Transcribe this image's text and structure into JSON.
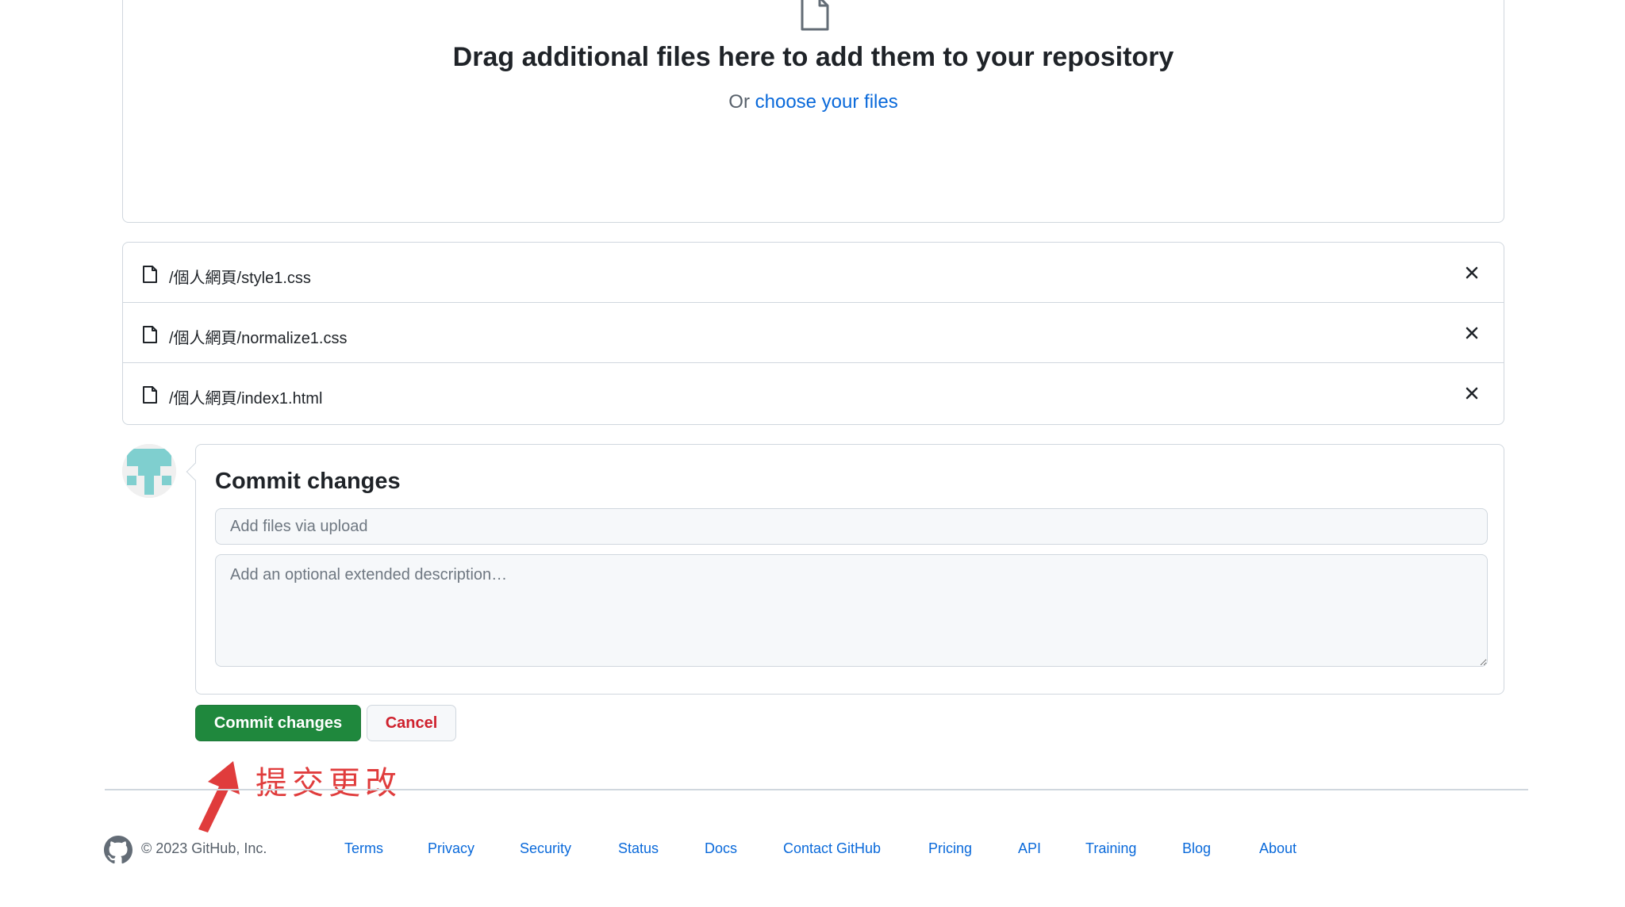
{
  "dropzone": {
    "icon": "file-icon",
    "title": "Drag additional files here to add them to your repository",
    "or_text": "Or",
    "choose_link": "choose your files"
  },
  "files": [
    {
      "icon": "file-icon",
      "name": "/個人網頁/style1.css"
    },
    {
      "icon": "file-icon",
      "name": "/個人網頁/normalize1.css"
    },
    {
      "icon": "file-icon",
      "name": "/個人網頁/index1.html"
    }
  ],
  "commit": {
    "heading": "Commit changes",
    "summary_placeholder": "Add files via upload",
    "description_placeholder": "Add an optional extended description…",
    "commit_button": "Commit changes",
    "cancel_button": "Cancel"
  },
  "annotation": {
    "text": "提交更改",
    "color": "#e03c3c"
  },
  "footer": {
    "copyright": "© 2023 GitHub, Inc.",
    "links": [
      "Terms",
      "Privacy",
      "Security",
      "Status",
      "Docs",
      "Contact GitHub",
      "Pricing",
      "API",
      "Training",
      "Blog",
      "About"
    ]
  },
  "colors": {
    "accent_link": "#0969da",
    "primary_button": "#1f883d",
    "danger_text": "#cf222e",
    "border": "#d0d7de"
  }
}
